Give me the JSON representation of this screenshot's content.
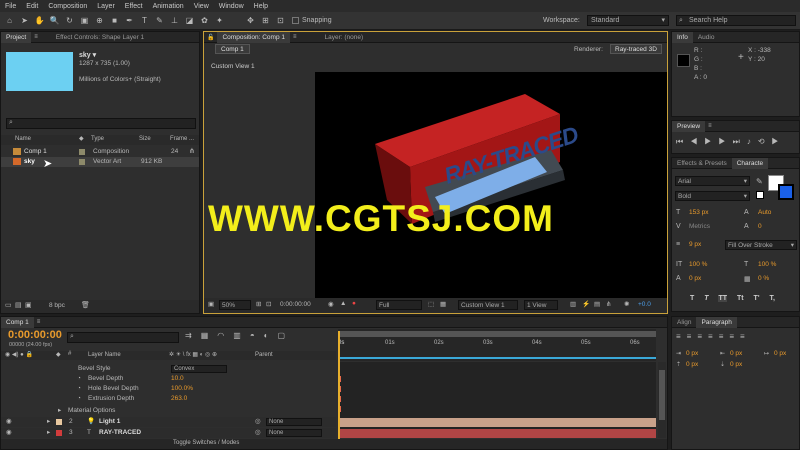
{
  "menu": [
    "File",
    "Edit",
    "Composition",
    "Layer",
    "Effect",
    "Animation",
    "View",
    "Window",
    "Help"
  ],
  "toolbar": {
    "snapping": "Snapping",
    "workspace_label": "Workspace:",
    "workspace_value": "Standard",
    "search_placeholder": "Search Help"
  },
  "project": {
    "tabs": [
      "Project",
      "Effect Controls: Shape Layer 1"
    ],
    "preview_name": "sky ▾",
    "preview_dims": "1287 x 735 (1.00)",
    "preview_colors": "Millions of Colors+ (Straight)",
    "columns": [
      "Name",
      "Type",
      "Size",
      "Frame ..."
    ],
    "items": [
      {
        "name": "Comp 1",
        "type": "Composition",
        "size": "",
        "frame": "24"
      },
      {
        "name": "sky",
        "type": "Vector Art",
        "size": "912 KB",
        "frame": ""
      }
    ],
    "bpc": "8 bpc"
  },
  "composition": {
    "tab": "Composition: Comp 1",
    "layer_tab": "Layer: (none)",
    "comp_button": "Comp 1",
    "renderer_label": "Renderer:",
    "renderer_value": "Ray-traced 3D",
    "view_label": "Custom View 1",
    "artwork_text": "RAY-TRACED",
    "footer": {
      "zoom": "50%",
      "time": "0:00:00:00",
      "resolution": "Full",
      "view": "Custom View 1",
      "views": "1 View",
      "exposure": "+0.0"
    }
  },
  "info": {
    "tabs": [
      "Info",
      "Audio"
    ],
    "r": "R :",
    "g": "G :",
    "b": "B :",
    "a": "A : 0",
    "x": "X : -338",
    "y": "Y : 20"
  },
  "preview": {
    "tab": "Preview"
  },
  "character": {
    "tabs": [
      "Effects & Presets",
      "Characte"
    ],
    "font": "Arial",
    "style": "Bold",
    "size": "153 px",
    "leading": "Auto",
    "kerning": "Metrics",
    "tracking": "0",
    "stroke": "9 px",
    "stroke_mode": "Fill Over Stroke",
    "vscale": "100 %",
    "hscale": "100 %",
    "baseline": "0 px",
    "tsume": "0 %",
    "styles": [
      "T",
      "T",
      "TT",
      "Tt",
      "T'",
      "T,"
    ]
  },
  "paragraph": {
    "tabs": [
      "Align",
      "Paragraph"
    ],
    "values": [
      "0 px",
      "0 px",
      "0 px",
      "0 px",
      "0 px"
    ]
  },
  "timeline": {
    "tab": "Comp 1",
    "timecode": "0:00:00:00",
    "fps": "00000 (24.00 fps)",
    "search_placeholder": "",
    "layer_col": "Layer Name",
    "parent_col": "Parent",
    "ticks": [
      "0s",
      "01s",
      "02s",
      "03s",
      "04s",
      "05s",
      "06s"
    ],
    "props": [
      {
        "name": "Bevel Style",
        "value": "Convex"
      },
      {
        "name": "Bevel Depth",
        "value": "10.0"
      },
      {
        "name": "Hole Bevel Depth",
        "value": "100.0%"
      },
      {
        "name": "Extrusion Depth",
        "value": "263.0"
      },
      {
        "name": "Material Options",
        "value": ""
      }
    ],
    "layers": [
      {
        "num": "2",
        "name": "Light 1",
        "parent": "None"
      },
      {
        "num": "3",
        "name": "RAY-TRACED",
        "parent": "None"
      }
    ],
    "toggle": "Toggle Switches / Modes"
  },
  "watermark": "WWW.CGTSJ.COM",
  "colors": {
    "sky": "#6cd0f2",
    "accent": "#e89a2c",
    "link": "#4c9ee8",
    "watermark": "#f3ee1b",
    "red_box": "#a31616"
  }
}
